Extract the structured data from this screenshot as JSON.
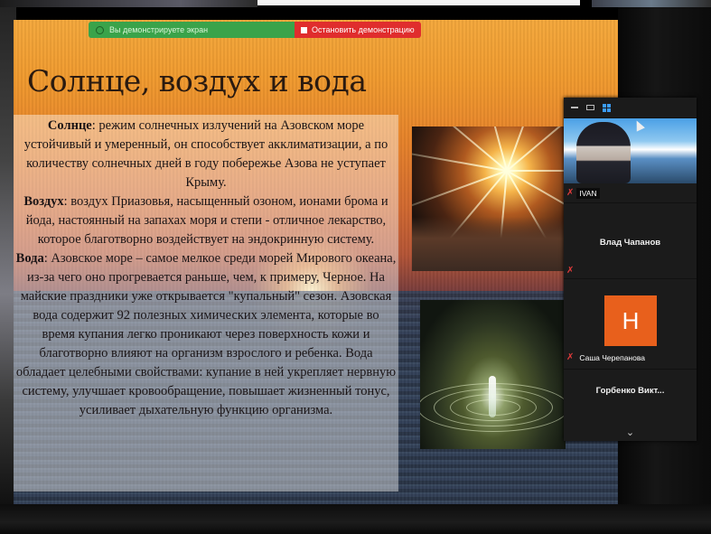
{
  "share_bar": {
    "status_text": "Вы демонстрируете экран",
    "stop_label": "Остановить демонстрацию"
  },
  "slide": {
    "title": "Солнце, воздух и вода",
    "sun_label": "Солнце",
    "sun_text": ": режим солнечных излучений на Азовском море устойчивый и умеренный, он способствует акклиматизации, а по количеству солнечных дней в году побережье Азова не уступает Крыму.",
    "air_label": "Воздух",
    "air_text": ": воздух Приазовья, насыщенный озоном, ионами брома и йода, настоянный на запахах моря и степи - отличное лекарство, которое благотворно воздействует на эндокринную систему.",
    "water_label": "Вода",
    "water_text": ": Азовское море – самое мелкое среди морей Мирового океана, из-за чего оно прогревается раньше, чем, к примеру, Черное. На майские праздники уже открывается \"купальный\" сезон. Азовская вода содержит 92 полезных химических элемента, которые во время купания легко проникают через поверхность кожи и благотворно влияют на организм взрослого и ребенка. Вода обладает целебными свойствами: купание в ней укрепляет нервную систему, улучшает кровообращение, повышает жизненный тонус, усиливает дыхательную функцию организма."
  },
  "participants": {
    "tiles": [
      {
        "name": "IVAN",
        "muted": true
      },
      {
        "name": "Влад Чапанов",
        "muted": true
      },
      {
        "name": "Саша Черепанова",
        "avatar_letter": "Н",
        "muted": true
      },
      {
        "name": "Горбенко Викт..."
      }
    ],
    "more_icon": "chevron-down-icon"
  },
  "colors": {
    "share_green": "#3aa34a",
    "stop_red": "#e02d2d",
    "avatar_orange": "#e8601c",
    "mic_muted": "#e23b3b"
  }
}
